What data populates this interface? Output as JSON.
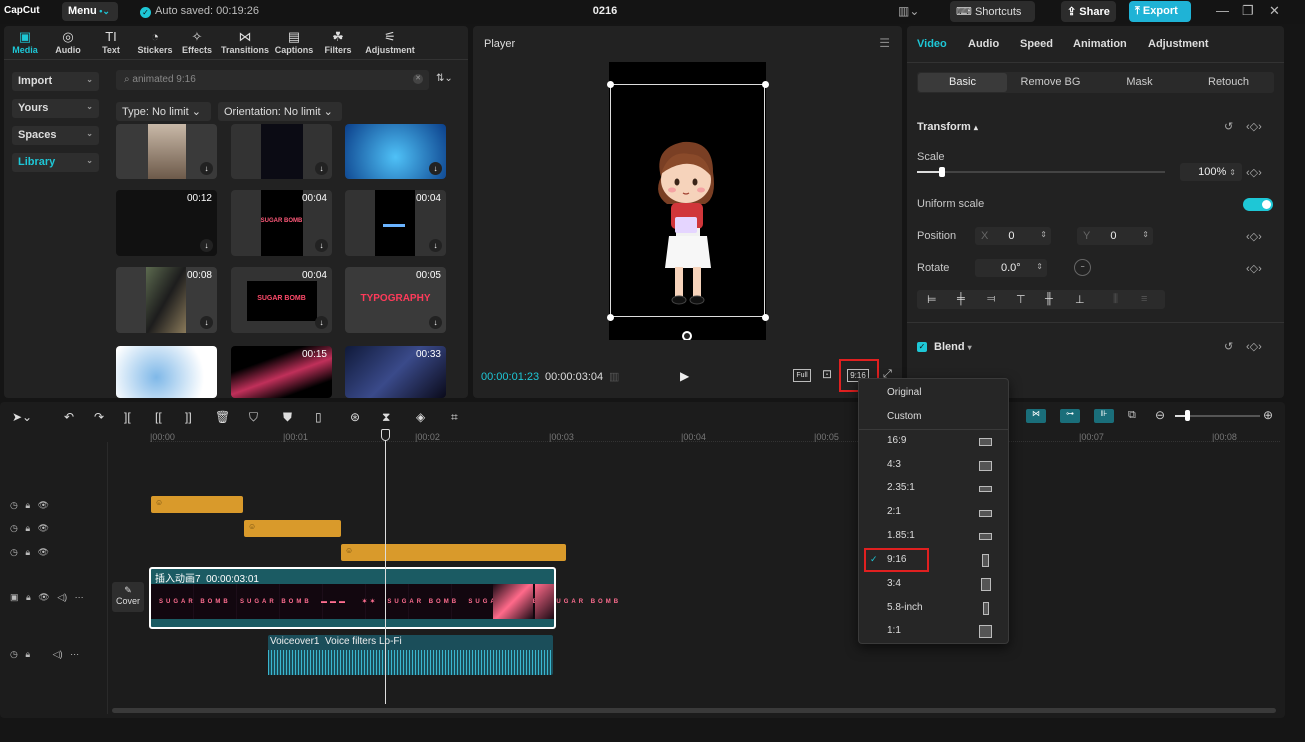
{
  "app": {
    "logo": "CapCut",
    "menu_label": "Menu",
    "autosave": "Auto saved: 00:19:26",
    "project_title": "0216",
    "shortcuts": "Shortcuts",
    "share": "Share",
    "export": "Export"
  },
  "media": {
    "tabs": [
      "Media",
      "Audio",
      "Text",
      "Stickers",
      "Effects",
      "Transitions",
      "Captions",
      "Filters",
      "Adjustment"
    ],
    "sidebar": [
      "Import",
      "Yours",
      "Spaces",
      "Library"
    ],
    "search_placeholder": "animated 9:16",
    "filter_type": "Type: No limit",
    "filter_orientation": "Orientation: No limit",
    "thumbs": [
      {
        "duration": "",
        "caption": ""
      },
      {
        "duration": "",
        "caption": ""
      },
      {
        "duration": "",
        "caption": ""
      },
      {
        "duration": "00:12",
        "caption": ""
      },
      {
        "duration": "00:04",
        "caption": "SUGAR BOMB"
      },
      {
        "duration": "00:04",
        "caption": ""
      },
      {
        "duration": "00:08",
        "caption": ""
      },
      {
        "duration": "00:04",
        "caption": "SUGAR BOMB"
      },
      {
        "duration": "00:05",
        "caption": "TYPOGRAPHY"
      },
      {
        "duration": "",
        "caption": ""
      },
      {
        "duration": "00:15",
        "caption": ""
      },
      {
        "duration": "00:33",
        "caption": ""
      }
    ]
  },
  "player": {
    "title": "Player",
    "current_time": "00:00:01:23",
    "total_time": "00:00:03:04",
    "full_label": "Full",
    "ratio_label": "9:16"
  },
  "inspector": {
    "tabs": [
      "Video",
      "Audio",
      "Speed",
      "Animation",
      "Adjustment"
    ],
    "subtabs": [
      "Basic",
      "Remove BG",
      "Mask",
      "Retouch"
    ],
    "transform": "Transform",
    "scale_label": "Scale",
    "scale_value": "100%",
    "scale_level": 0.1,
    "uniform_scale": "Uniform scale",
    "position_label": "Position",
    "pos_x_label": "X",
    "pos_x": "0",
    "pos_y_label": "Y",
    "pos_y": "0",
    "rotate_label": "Rotate",
    "rotate_value": "0.0°",
    "blend": "Blend"
  },
  "timeline": {
    "ruler": [
      "|00:00",
      "|00:01",
      "|00:02",
      "|00:03",
      "|00:04",
      "|00:05",
      "|00:07",
      "|00:08"
    ],
    "video_clip_name": "插入动画7",
    "video_clip_duration": "00:00:03:01",
    "cover_label": "Cover",
    "audio_clip_name": "Voiceover1",
    "audio_clip_filter": "Voice filters Lo-Fi"
  },
  "ratio_menu": {
    "top": [
      "Original",
      "Custom"
    ],
    "items": [
      "16:9",
      "4:3",
      "2.35:1",
      "2:1",
      "1.85:1",
      "9:16",
      "3:4",
      "5.8-inch",
      "1:1"
    ],
    "selected": "9:16"
  },
  "colors": {
    "accent": "#1ec7d6",
    "highlight_box": "#e02020",
    "sticker_clip": "#d99a2b"
  }
}
